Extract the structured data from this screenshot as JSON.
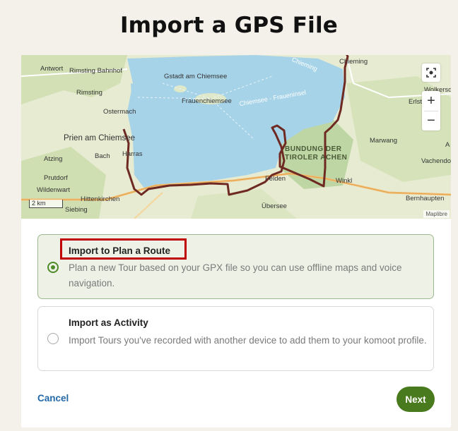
{
  "page": {
    "title": "Import a GPS File"
  },
  "map": {
    "labels": {
      "antwort": "Antwort",
      "rimsting_bahnhof": "Rimsting Bahnhof",
      "gstadt": "Gstadt am Chiemsee",
      "chieming_lake": "Chieming",
      "chieming_town": "Chieming",
      "rimsting": "Rimsting",
      "frauenchiemsee": "Frauenchiemsee",
      "chiemsee_frauen": "Chiemsee - Fraueninsel",
      "wolkersdorf": "Wolkersd",
      "erlstatt": "Erlst",
      "ostermach": "Ostermach",
      "prien": "Prien am Chiemsee",
      "harras": "Harras",
      "bach": "Bach",
      "atzing": "Atzing",
      "marwang": "Marwang",
      "park_line1": "BUNDUNG DER",
      "park_line2": "TIROLER ACHEN",
      "a_right": "A",
      "vachendorf": "Vachendo",
      "prutdorf": "Prutdorf",
      "felden": "Felden",
      "winkl": "Winkl",
      "wildenwart": "Wildenwart",
      "hittenkirchen": "Hittenkirchen",
      "bernhaupten": "Bernhaupten",
      "ubersee": "Übersee",
      "siebing": "Siebing"
    },
    "scale": "2 km",
    "attribution": "Maplibre",
    "controls": {
      "zoom_in": "+",
      "zoom_out": "−"
    }
  },
  "options": [
    {
      "title": "Import to Plan a Route",
      "description": "Plan a new Tour based on your GPX file so you can use offline maps and voice navigation.",
      "selected": true
    },
    {
      "title": "Import as Activity",
      "description": "Import Tours you've recorded with another device to add them to your komoot profile.",
      "selected": false
    }
  ],
  "actions": {
    "cancel": "Cancel",
    "next": "Next"
  },
  "colors": {
    "accent_green": "#4a7a1e",
    "link_blue": "#2369a8",
    "highlight_red": "#c00000",
    "route": "#6e2a22",
    "lake": "#a7d3e8"
  },
  "icons": {
    "locate": "locate-icon",
    "zoom_in": "zoom-in-icon",
    "zoom_out": "zoom-out-icon"
  }
}
